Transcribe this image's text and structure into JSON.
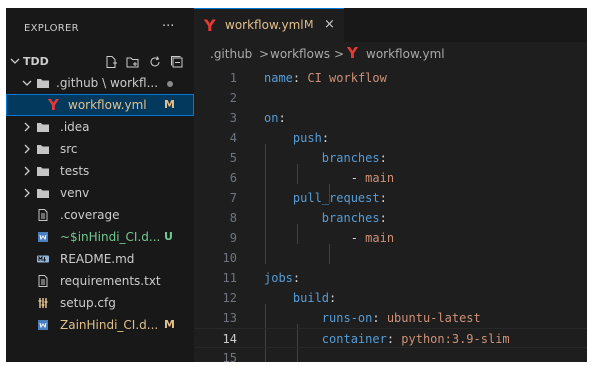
{
  "sidebar": {
    "title": "EXPLORER",
    "more": "···",
    "project": "TDD",
    "items": [
      {
        "label": ".github \\ workfl...",
        "status": "dot",
        "color": "#cccccc"
      },
      {
        "label": "workflow.yml",
        "badge": "M",
        "color": "#e2c08d"
      },
      {
        "label": ".idea",
        "badge": "",
        "color": "#cccccc"
      },
      {
        "label": "src",
        "badge": "",
        "color": "#cccccc"
      },
      {
        "label": "tests",
        "badge": "",
        "color": "#cccccc"
      },
      {
        "label": "venv",
        "badge": "",
        "color": "#cccccc"
      },
      {
        "label": ".coverage",
        "badge": "",
        "color": "#cccccc"
      },
      {
        "label": "~$inHindi_CI.d...",
        "badge": "U",
        "color": "#73c991"
      },
      {
        "label": "README.md",
        "badge": "",
        "color": "#cccccc"
      },
      {
        "label": "requirements.txt",
        "badge": "",
        "color": "#cccccc"
      },
      {
        "label": "setup.cfg",
        "badge": "",
        "color": "#cccccc"
      },
      {
        "label": "ZainHindi_CI.d...",
        "badge": "M",
        "color": "#e2c08d"
      }
    ]
  },
  "tab": {
    "name": "workflow.yml",
    "modified": "M",
    "close": "×"
  },
  "breadcrumb": {
    "parts": [
      ".github",
      "workflows",
      "workflow.yml"
    ],
    "sep": ">"
  },
  "editor": {
    "current_line": 14,
    "lines": [
      {
        "n": "1",
        "text": "name: CI workflow"
      },
      {
        "n": "2",
        "text": ""
      },
      {
        "n": "3",
        "text": "on:"
      },
      {
        "n": "4",
        "text": "    push:"
      },
      {
        "n": "5",
        "text": "        branches:"
      },
      {
        "n": "6",
        "text": "            - main"
      },
      {
        "n": "7",
        "text": "    pull_request:"
      },
      {
        "n": "8",
        "text": "        branches:"
      },
      {
        "n": "9",
        "text": "            - main"
      },
      {
        "n": "10",
        "text": ""
      },
      {
        "n": "11",
        "text": "jobs:"
      },
      {
        "n": "12",
        "text": "    build:"
      },
      {
        "n": "13",
        "text": "        runs-on: ubuntu-latest"
      },
      {
        "n": "14",
        "text": "        container: python:3.9-slim"
      },
      {
        "n": "15",
        "text": ""
      }
    ],
    "colors": {
      "key": "#569cd6",
      "string": "#ce9178",
      "text": "#d4d4d4"
    }
  }
}
